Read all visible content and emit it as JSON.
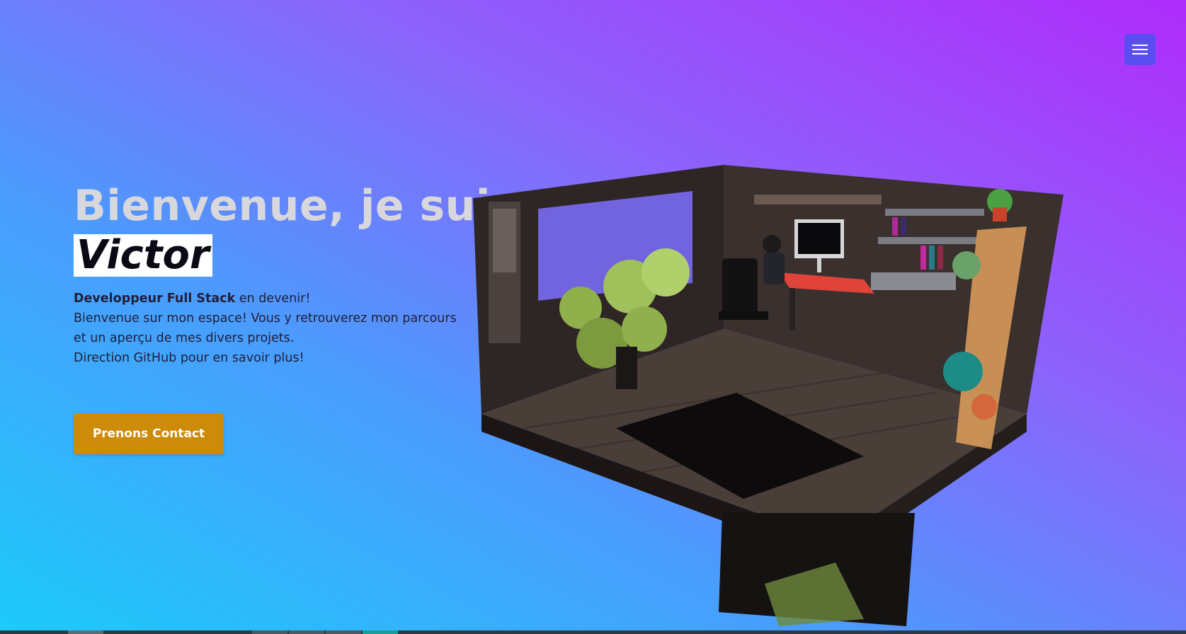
{
  "nav": {
    "menu_icon": "hamburger-menu-icon"
  },
  "hero": {
    "title": "Bienvenue, je suis",
    "name": "Victor",
    "role_bold": "Developpeur Full Stack",
    "role_rest": " en devenir!",
    "description_line1": "Bienvenue sur mon espace! Vous y retrouverez mon parcours et un aperçu de mes divers projets.",
    "description_line2": "Direction GitHub pour en savoir plus!",
    "cta_label": "Prenons Contact"
  },
  "colors": {
    "gradient_top_right": "#b02cfb",
    "gradient_bottom_left": "#1ccbf9",
    "menu_button": "#5a4ef0",
    "cta_button": "#cc8b08",
    "title_text": "#d8d8dc"
  }
}
